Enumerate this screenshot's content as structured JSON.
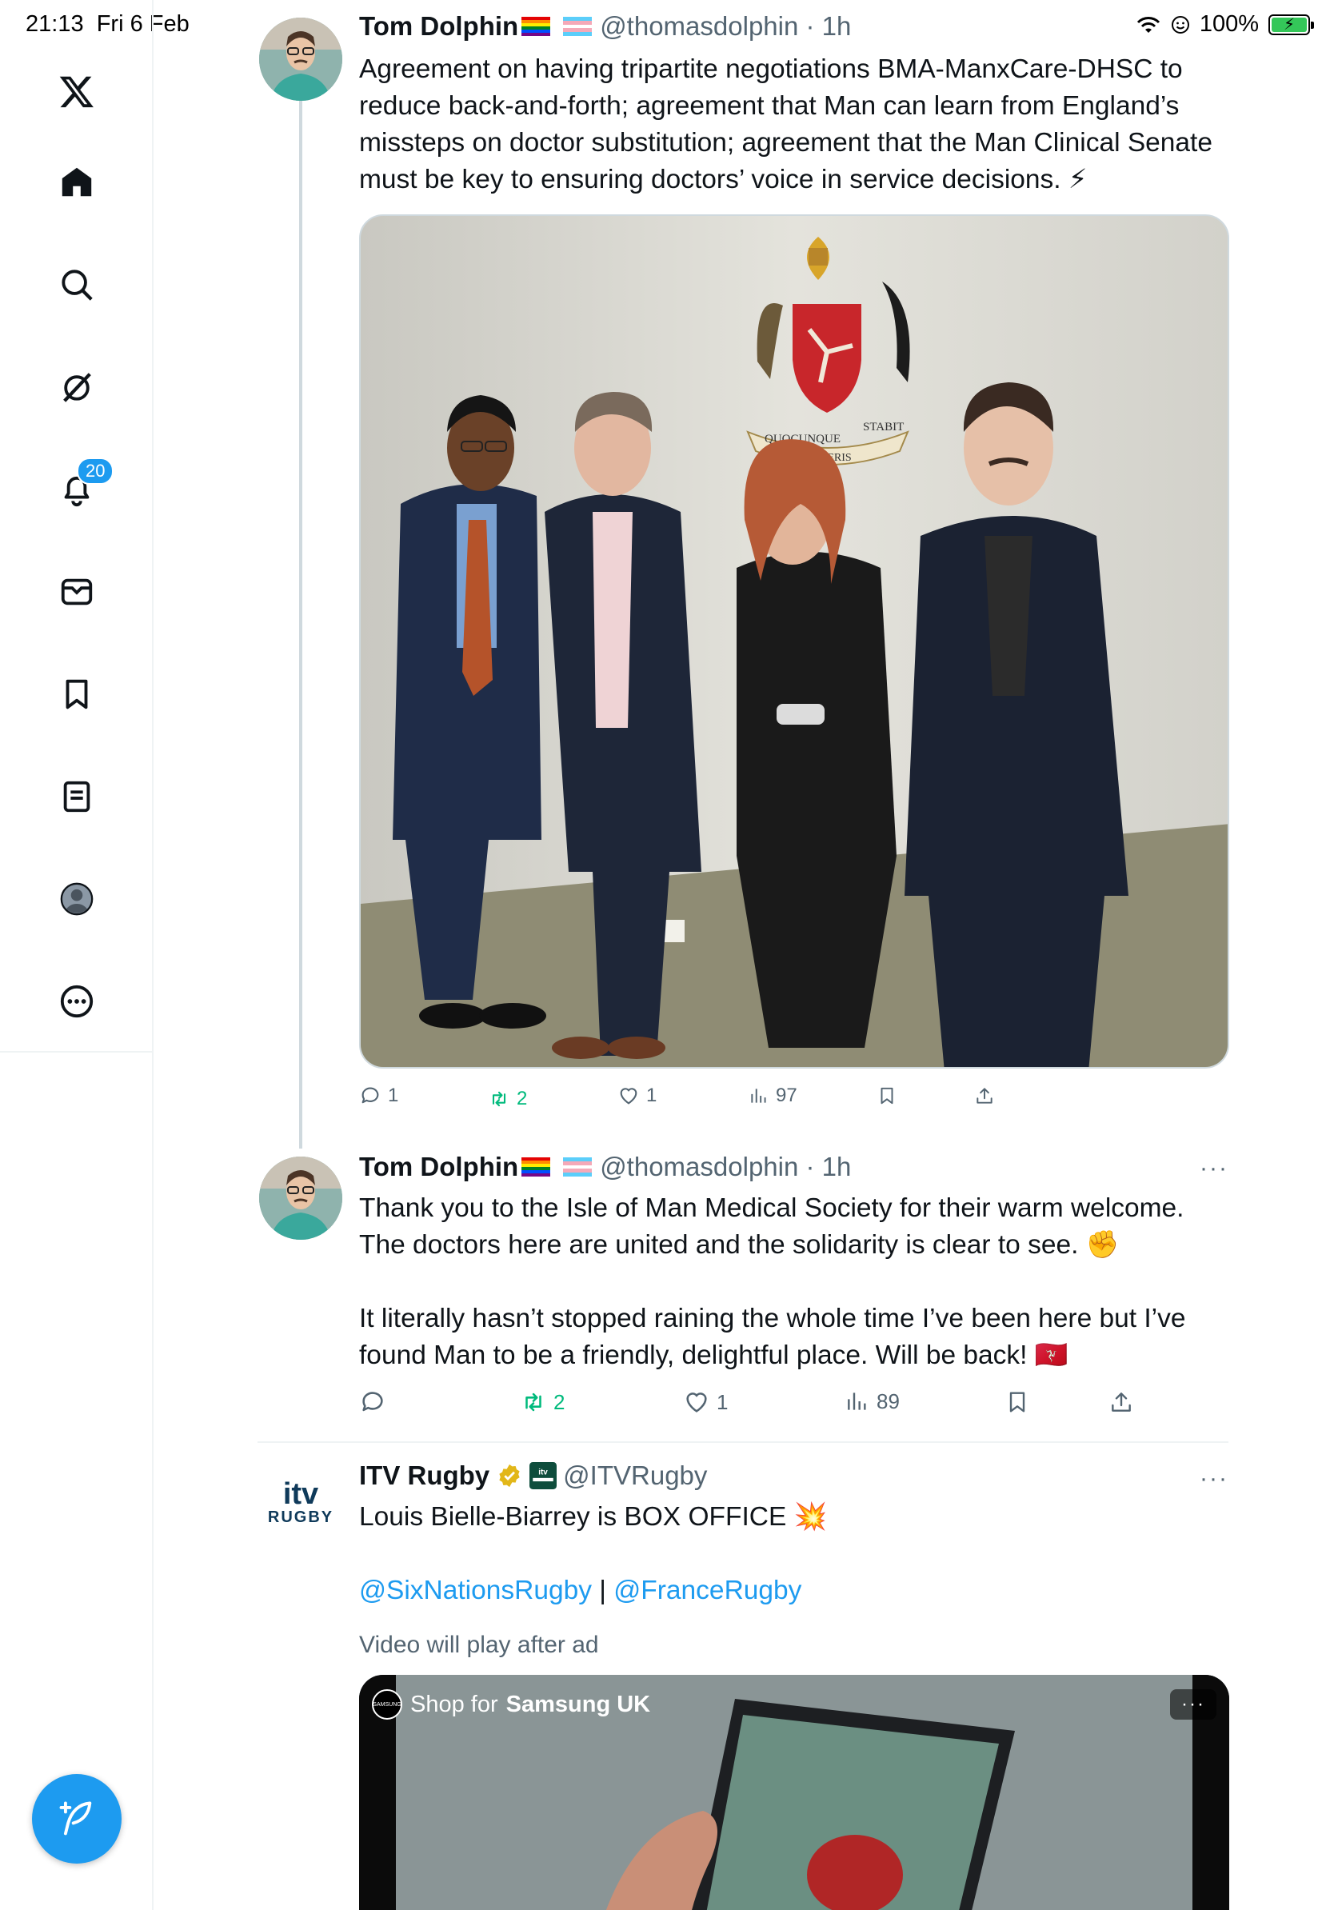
{
  "status_bar": {
    "time": "21:13",
    "date": "Fri 6 Feb",
    "battery": "100%",
    "battery_level": 1.0
  },
  "sidebar": {
    "notifications_badge": "20",
    "items": [
      {
        "name": "x-logo",
        "icon": "x-logo-icon"
      },
      {
        "name": "home",
        "icon": "home-icon"
      },
      {
        "name": "search",
        "icon": "search-icon"
      },
      {
        "name": "grok",
        "icon": "grok-icon"
      },
      {
        "name": "notifications",
        "icon": "bell-icon"
      },
      {
        "name": "messages",
        "icon": "envelope-icon"
      },
      {
        "name": "bookmarks",
        "icon": "bookmark-icon"
      },
      {
        "name": "lists",
        "icon": "list-icon"
      },
      {
        "name": "profile",
        "icon": "profile-icon"
      },
      {
        "name": "more",
        "icon": "more-circle-icon"
      }
    ],
    "compose_icon": "compose-feather-icon"
  },
  "tweets": [
    {
      "author": "Tom Dolphin",
      "handle": "@thomasdolphin",
      "time": "1h",
      "text": "Agreement on having tripartite negotiations BMA-ManxCare-DHSC to reduce back-and-forth; agreement that Man can learn from England’s missteps on doctor substitution; agreement that the Man Clinical Senate must be key to ensuring doctors’ voice in service decisions. ⚡",
      "crest_text_left": "QUOCUNQUE",
      "crest_text_mid": "JECERIS",
      "crest_text_right": "STABIT",
      "replies": "1",
      "reposts": "2",
      "likes": "1",
      "views": "97"
    },
    {
      "author": "Tom Dolphin",
      "handle": "@thomasdolphin",
      "time": "1h",
      "text_p1": "Thank you to the Isle of Man Medical Society for their warm welcome. The doctors here are united and the solidarity is clear to see. ✊",
      "text_p2": "It literally hasn’t stopped raining the whole time I’ve been here but I’ve found Man to be a friendly, delightful place. Will be back! 🇮🇲",
      "replies": "",
      "reposts": "2",
      "likes": "1",
      "views": "89"
    },
    {
      "author": "ITV Rugby",
      "handle": "@ITVRugby",
      "logo_top": "itv",
      "logo_bottom": "RUGBY",
      "text": "Louis Bielle-Biarrey is BOX OFFICE 💥",
      "mention1": "@SixNationsRugby",
      "separator": "|",
      "mention2": "@FranceRugby",
      "caption": "Video will play after ad",
      "ad_prefix": "Shop for",
      "ad_brand": "Samsung UK",
      "ad_logo_text": "SAMSUNG"
    }
  ],
  "colors": {
    "accent": "#1d9bf0",
    "repost_green": "#00ba7c",
    "secondary_text": "#536471",
    "divider": "#eff3f4"
  }
}
